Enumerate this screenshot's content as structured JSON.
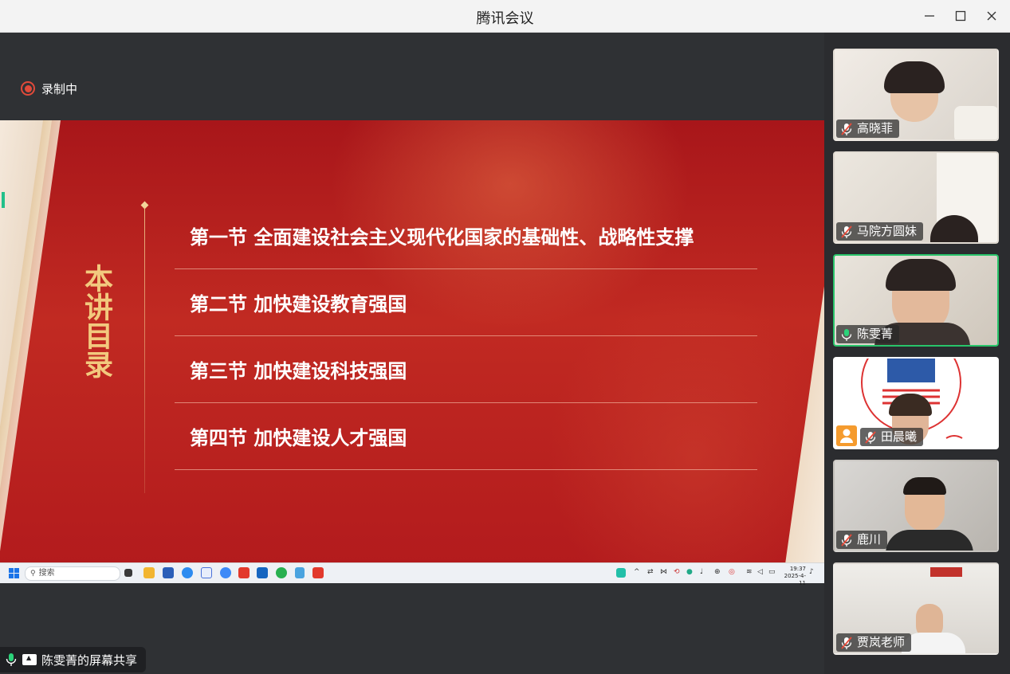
{
  "window": {
    "title": "腾讯会议"
  },
  "recording": {
    "label": "录制中"
  },
  "slide": {
    "side_title": "本讲目录",
    "items": [
      "第一节 全面建设社会主义现代化国家的基础性、战略性支撑",
      "第二节 加快建设教育强国",
      "第三节 加快建设科技强国",
      "第四节 加快建设人才强国"
    ]
  },
  "taskbar": {
    "search_placeholder": "搜索",
    "clock_time": "19:37",
    "clock_date": "2025-4-11"
  },
  "share": {
    "label": "陈雯菁的屏幕共享"
  },
  "participants": [
    {
      "name": "高晓菲",
      "muted": true
    },
    {
      "name": "马院方圆妹",
      "muted": true
    },
    {
      "name": "陈雯菁",
      "muted": false,
      "speaking": true
    },
    {
      "name": "田晨曦",
      "muted": true
    },
    {
      "name": "鹿川",
      "muted": true
    },
    {
      "name": "贾岚老师",
      "muted": true
    }
  ],
  "colors": {
    "accent_green": "#28c46a",
    "recording_red": "#e04a3a",
    "slide_red": "#b41c1c",
    "gold": "#f2c97e"
  }
}
